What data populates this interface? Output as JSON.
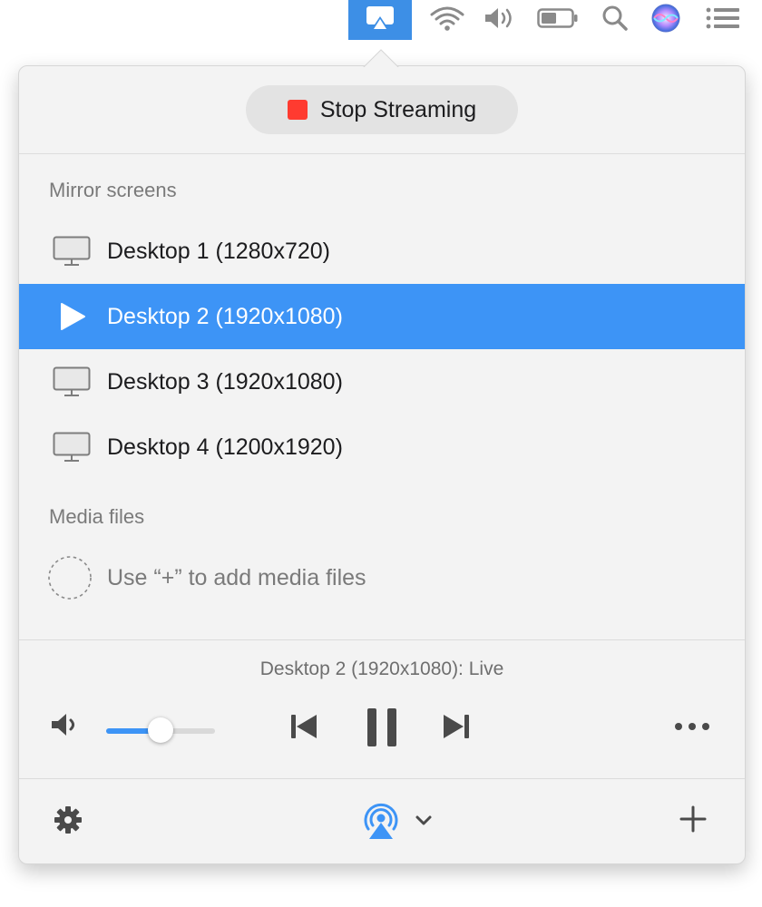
{
  "colors": {
    "accent": "#3d94f6",
    "menubar_highlight": "#3d8fe6",
    "stop": "#ff3b30",
    "popover_bg": "#f3f3f3"
  },
  "menubar": {
    "icons": [
      "airplay-icon",
      "wifi-icon",
      "volume-icon",
      "battery-icon",
      "search-icon",
      "siri-icon",
      "list-icon"
    ],
    "active": "airplay-icon"
  },
  "header": {
    "stop_label": "Stop Streaming"
  },
  "mirror": {
    "section_label": "Mirror screens",
    "screens": [
      {
        "label": "Desktop 1 (1280x720)",
        "selected": false
      },
      {
        "label": "Desktop 2 (1920x1080)",
        "selected": true
      },
      {
        "label": "Desktop 3 (1920x1080)",
        "selected": false
      },
      {
        "label": "Desktop 4 (1200x1920)",
        "selected": false
      }
    ]
  },
  "media": {
    "section_label": "Media files",
    "placeholder": "Use “+” to add media files"
  },
  "player": {
    "now_playing": "Desktop 2 (1920x1080): Live",
    "volume": 0.5
  },
  "footer": {
    "icons": [
      "gear-icon",
      "airplay-target-icon",
      "chevron-down-icon",
      "plus-icon"
    ]
  }
}
